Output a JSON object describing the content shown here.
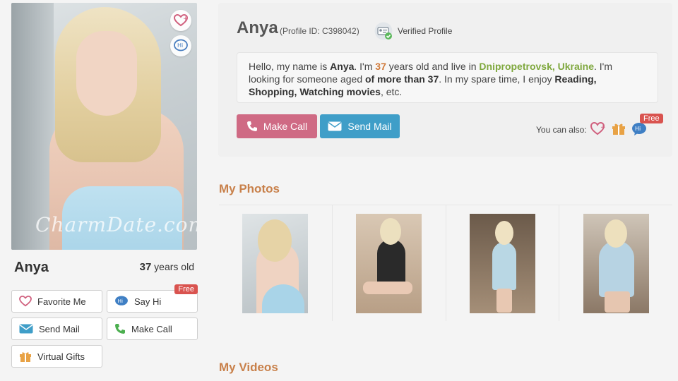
{
  "profile": {
    "name": "Anya",
    "profile_id_text": "(Profile ID: C398042)",
    "verified_label": "Verified Profile",
    "age_number": "37",
    "age_suffix": " years old",
    "watermark": "CharmDate.com"
  },
  "intro": {
    "p1": "Hello, my name is ",
    "name": "Anya",
    "p2": ". I'm ",
    "age": "37",
    "p3": " years old and live in ",
    "city": "Dnipropetrovsk, Ukraine",
    "p4": ". I'm looking for someone aged ",
    "aged": "of more than 37",
    "p5": ". In my spare time, I enjoy ",
    "hobbies": "Reading, Shopping, Watching movies",
    "p6": ", etc."
  },
  "actions": {
    "make_call": "Make Call",
    "send_mail": "Send Mail",
    "you_can_also": "You can also:",
    "free": "Free"
  },
  "side_buttons": {
    "favorite": "Favorite Me",
    "say_hi": "Say Hi",
    "send_mail": "Send Mail",
    "make_call": "Make Call",
    "virtual_gifts": "Virtual Gifts",
    "free": "Free"
  },
  "sections": {
    "photos": "My Photos",
    "videos": "My Videos"
  },
  "colors": {
    "call": "#cf6a84",
    "mail": "#3f9ec8",
    "section": "#c8804a",
    "free_badge": "#d9534f"
  }
}
